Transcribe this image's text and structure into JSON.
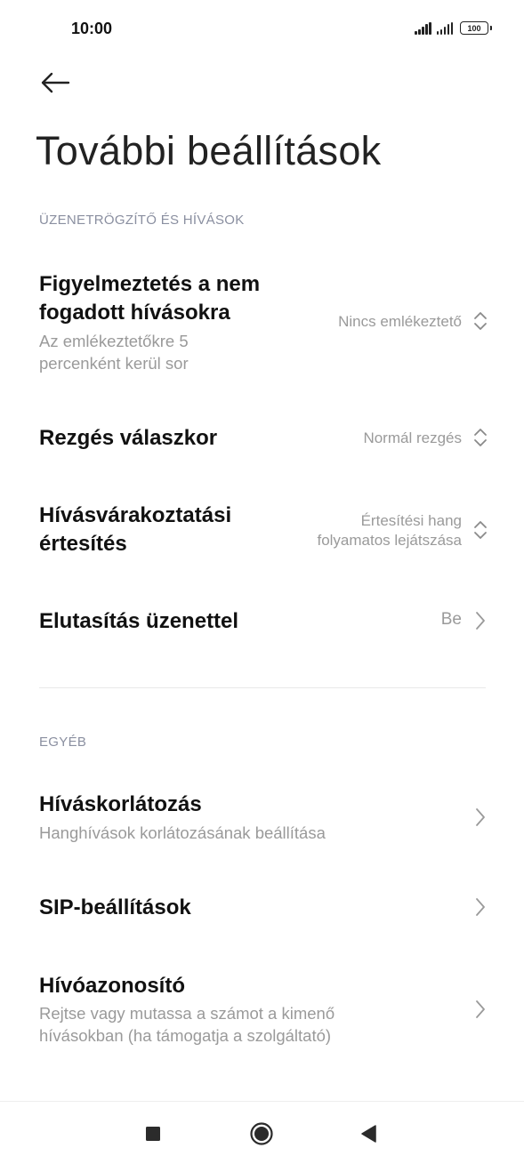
{
  "status_bar": {
    "time": "10:00",
    "battery_level": "100"
  },
  "header": {
    "back_icon": "arrow-left-icon",
    "title": "További beállítások"
  },
  "sections": {
    "voicemail_calls": {
      "header": "ÜZENETRÖGZÍTŐ ÉS HÍVÁSOK",
      "missed_call_alert": {
        "title_line1": "Figyelmeztetés a nem",
        "title_line2": "fogadott hívásokra",
        "subtitle_line1": "Az emlékeztetőkre 5",
        "subtitle_line2": "percenként kerül sor",
        "value": "Nincs emlékeztető",
        "icon": "chevron-updown-icon"
      },
      "vibrate_on_answer": {
        "title": "Rezgés válaszkor",
        "value": "Normál rezgés",
        "icon": "chevron-updown-icon"
      },
      "call_waiting_notification": {
        "title_line1": "Hívásvárakoztatási",
        "title_line2": "értesítés",
        "value_line1": "Értesítési hang",
        "value_line2": "folyamatos lejátszása",
        "icon": "chevron-updown-icon"
      },
      "reject_with_message": {
        "title": "Elutasítás üzenettel",
        "value": "Be",
        "icon": "chevron-right-icon"
      }
    },
    "other": {
      "header": "EGYÉB",
      "call_barring": {
        "title": "Híváskorlátozás",
        "subtitle": "Hanghívások korlátozásának beállítása",
        "icon": "chevron-right-icon"
      },
      "sip_settings": {
        "title": "SIP-beállítások",
        "icon": "chevron-right-icon"
      },
      "caller_id": {
        "title": "Hívóazonosító",
        "subtitle_line1": "Rejtse vagy mutassa a számot a kimenő",
        "subtitle_line2": "hívásokban (ha támogatja a szolgáltató)",
        "icon": "chevron-right-icon"
      }
    }
  },
  "nav_bar": {
    "recents_icon": "square-icon",
    "home_icon": "circle-icon",
    "back_icon": "triangle-back-icon"
  },
  "colors": {
    "background": "#ffffff",
    "title_text": "#111111",
    "secondary_text": "#9a9a9a",
    "section_header": "#8a8fa0",
    "divider": "#e8e8e8"
  }
}
